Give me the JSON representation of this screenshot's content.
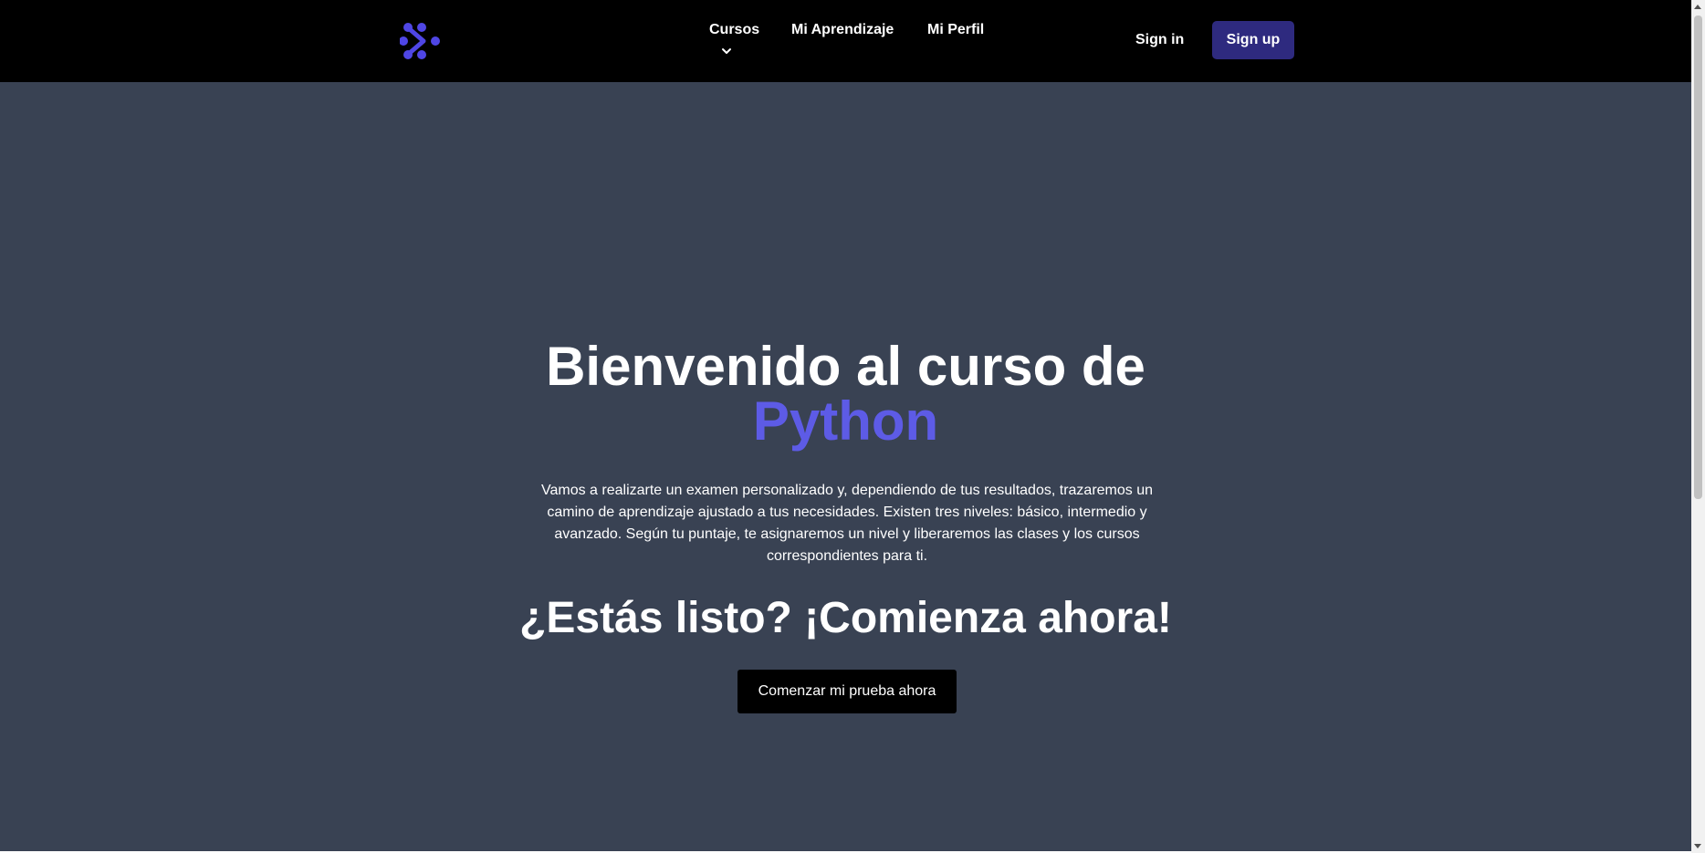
{
  "header": {
    "logo_icon": "brand-logo-icon",
    "nav": {
      "cursos": "Cursos",
      "mi_aprendizaje": "Mi Aprendizaje",
      "mi_perfil": "Mi Perfil"
    },
    "sign_in": "Sign in",
    "sign_up": "Sign up"
  },
  "hero": {
    "title": "Bienvenido al curso de",
    "title_accent": "Python",
    "description": "Vamos a realizarte un examen personalizado y, dependiendo de tus resultados, trazaremos un camino de aprendizaje ajustado a tus necesidades. Existen tres niveles: básico, intermedio y avanzado. Según tu puntaje, te asignaremos un nivel y liberaremos las clases y los cursos correspondientes para ti.",
    "cta_title": "¿Estás listo? ¡Comienza ahora!",
    "cta_button": "Comenzar mi prueba ahora"
  },
  "colors": {
    "header_bg": "#000000",
    "hero_bg": "#394253",
    "accent": "#5d5be6",
    "signup_bg": "#2e2a7f",
    "button_bg": "#000000"
  }
}
